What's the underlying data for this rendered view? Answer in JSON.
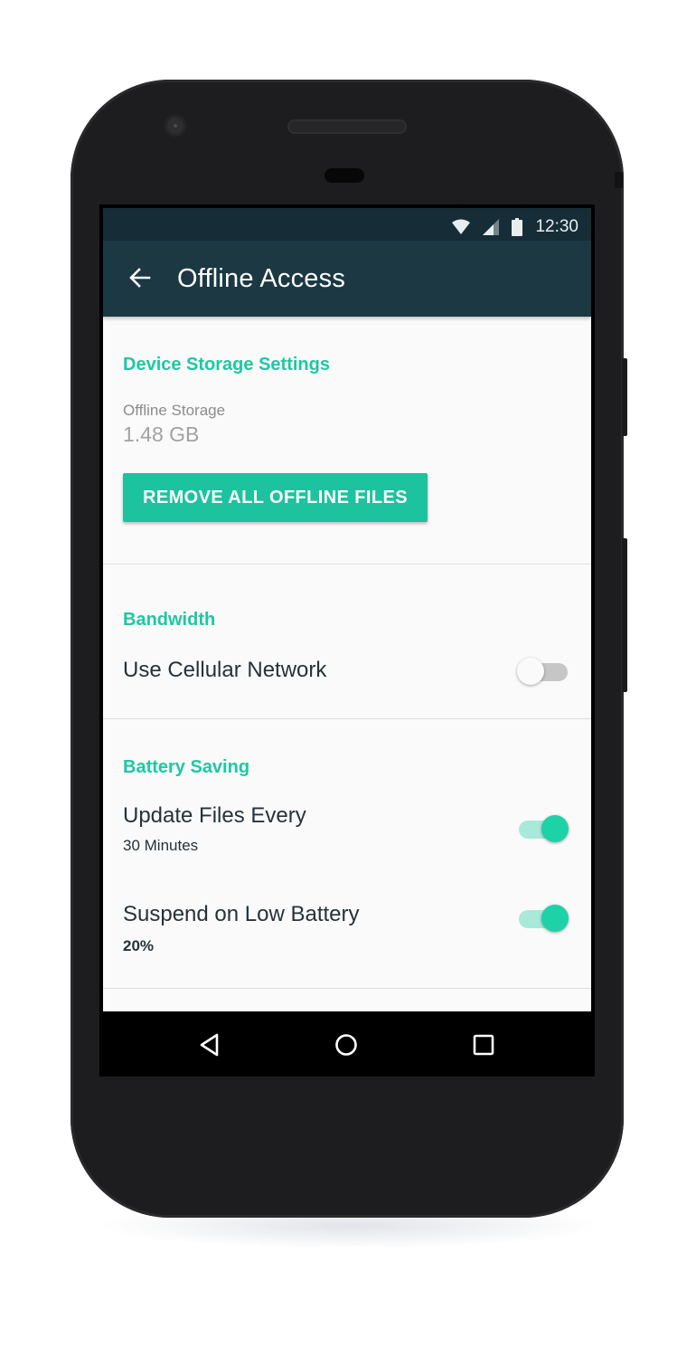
{
  "status_bar": {
    "time": "12:30",
    "icons": [
      "wifi-icon",
      "cell-signal-icon",
      "battery-icon"
    ]
  },
  "app_bar": {
    "back_icon": "arrow-left-icon",
    "title": "Offline Access"
  },
  "storage": {
    "section_title": "Device Storage Settings",
    "label": "Offline Storage",
    "value": "1.48 GB",
    "remove_button_label": "REMOVE ALL OFFLINE FILES"
  },
  "bandwidth": {
    "section_title": "Bandwidth",
    "cellular_label": "Use Cellular Network",
    "cellular_enabled": false
  },
  "battery": {
    "section_title": "Battery Saving",
    "update_label": "Update Files Every",
    "update_value": "30 Minutes",
    "update_enabled": true,
    "suspend_label": "Suspend on Low Battery",
    "suspend_value": "20%",
    "suspend_enabled": true
  },
  "nav_bar": {
    "buttons": [
      "back-triangle-icon",
      "home-circle-icon",
      "recents-square-icon"
    ]
  },
  "colors": {
    "accent": "#1dc8a2",
    "app_bar": "#1b3843",
    "status_bar": "#162d37",
    "button": "#1dc29e"
  }
}
